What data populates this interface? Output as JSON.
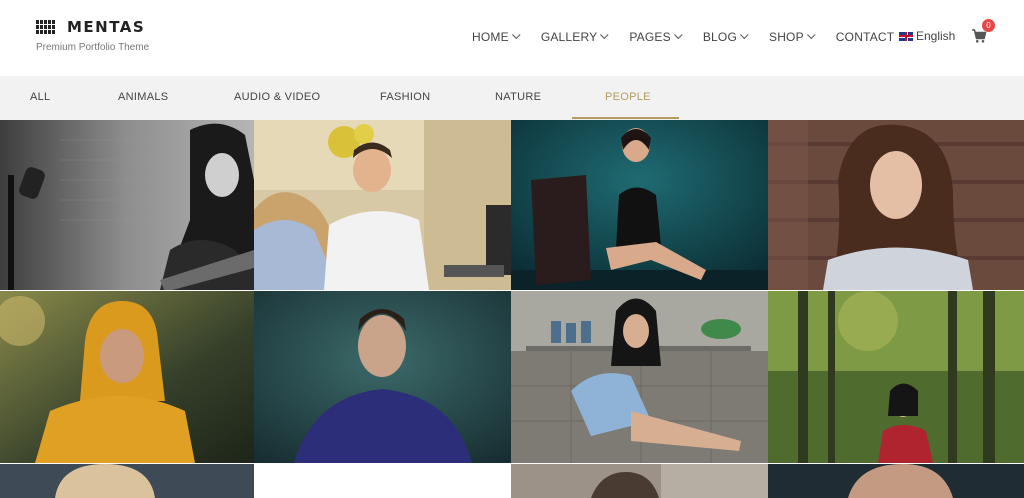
{
  "brand": {
    "name": "MENTAS",
    "tagline": "Premium Portfolio Theme"
  },
  "nav": {
    "items": [
      {
        "label": "HOME",
        "dropdown": true
      },
      {
        "label": "GALLERY",
        "dropdown": true
      },
      {
        "label": "PAGES",
        "dropdown": true
      },
      {
        "label": "BLOG",
        "dropdown": true
      },
      {
        "label": "SHOP",
        "dropdown": true
      },
      {
        "label": "CONTACT",
        "dropdown": false
      }
    ],
    "language": "English",
    "cart_count": "0"
  },
  "filters": {
    "items": [
      "ALL",
      "ANIMALS",
      "AUDIO & VIDEO",
      "FASHION",
      "NATURE",
      "PEOPLE"
    ],
    "active": "PEOPLE",
    "accent_color": "#b59b62"
  },
  "gallery": {
    "tiles": [
      {
        "subject": "woman-with-guitar-and-microphone"
      },
      {
        "subject": "man-in-office-meeting"
      },
      {
        "subject": "woman-in-black-dress-on-chair"
      },
      {
        "subject": "woman-portrait-wood-background"
      },
      {
        "subject": "man-in-yellow-hoodie"
      },
      {
        "subject": "man-in-blue-shirt"
      },
      {
        "subject": "woman-sitting-in-kitchen"
      },
      {
        "subject": "woman-in-forest"
      },
      {
        "subject": "blonde-woman-portrait"
      },
      {
        "subject": "white-tile"
      },
      {
        "subject": "person-portrait"
      },
      {
        "subject": "man-portrait"
      }
    ]
  }
}
